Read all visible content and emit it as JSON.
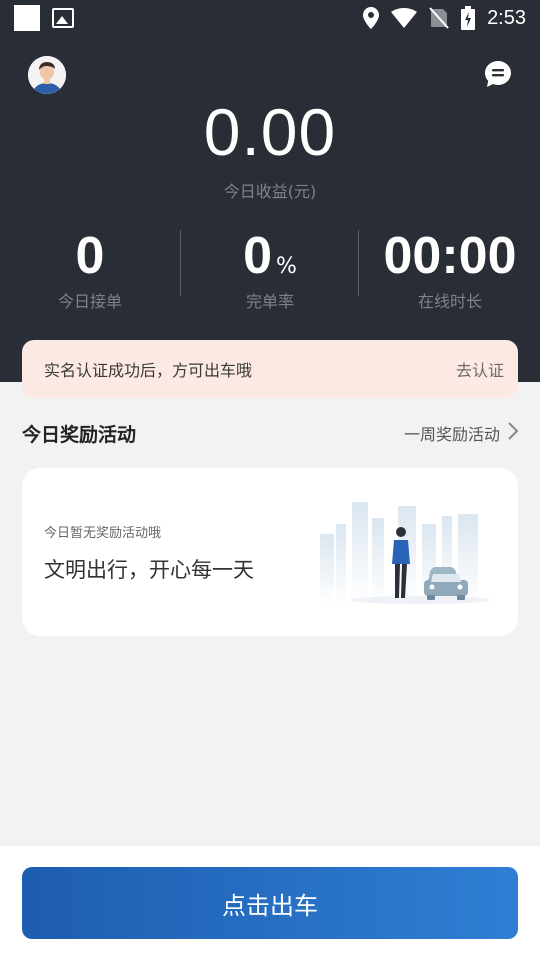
{
  "status_bar": {
    "time": "2:53",
    "icons": [
      "square-icon",
      "image-icon",
      "location-icon",
      "wifi-icon",
      "signal-off-icon",
      "battery-charging-icon"
    ]
  },
  "header": {
    "earnings_value": "0.00",
    "earnings_label": "今日收益(元)",
    "stats": [
      {
        "value": "0",
        "unit": "",
        "label": "今日接单"
      },
      {
        "value": "0",
        "unit": "%",
        "label": "完单率"
      },
      {
        "value": "00:00",
        "unit": "",
        "label": "在线时长"
      }
    ]
  },
  "verify_banner": {
    "text": "实名认证成功后，方可出车哦",
    "action": "去认证"
  },
  "activities": {
    "title": "今日奖励活动",
    "link": "一周奖励活动",
    "empty_sub": "今日暂无奖励活动哦",
    "empty_main": "文明出行，开心每一天"
  },
  "bottom": {
    "button_label": "点击出车"
  },
  "colors": {
    "header_bg": "#282d36",
    "banner_bg": "#fde9e4",
    "button_start": "#1e5db0",
    "button_end": "#2e7fd4"
  }
}
